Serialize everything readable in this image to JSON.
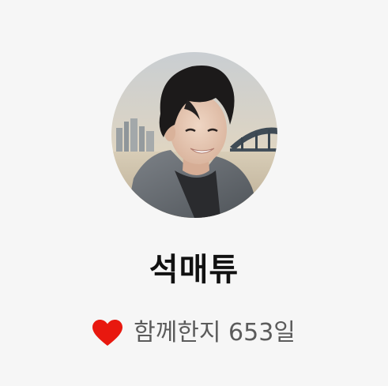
{
  "profile": {
    "name": "석매튜",
    "together_label": "함께한지 653일",
    "avatar_icon": "profile-photo",
    "heart_icon": "heart-icon",
    "heart_color": "#e8180f"
  }
}
